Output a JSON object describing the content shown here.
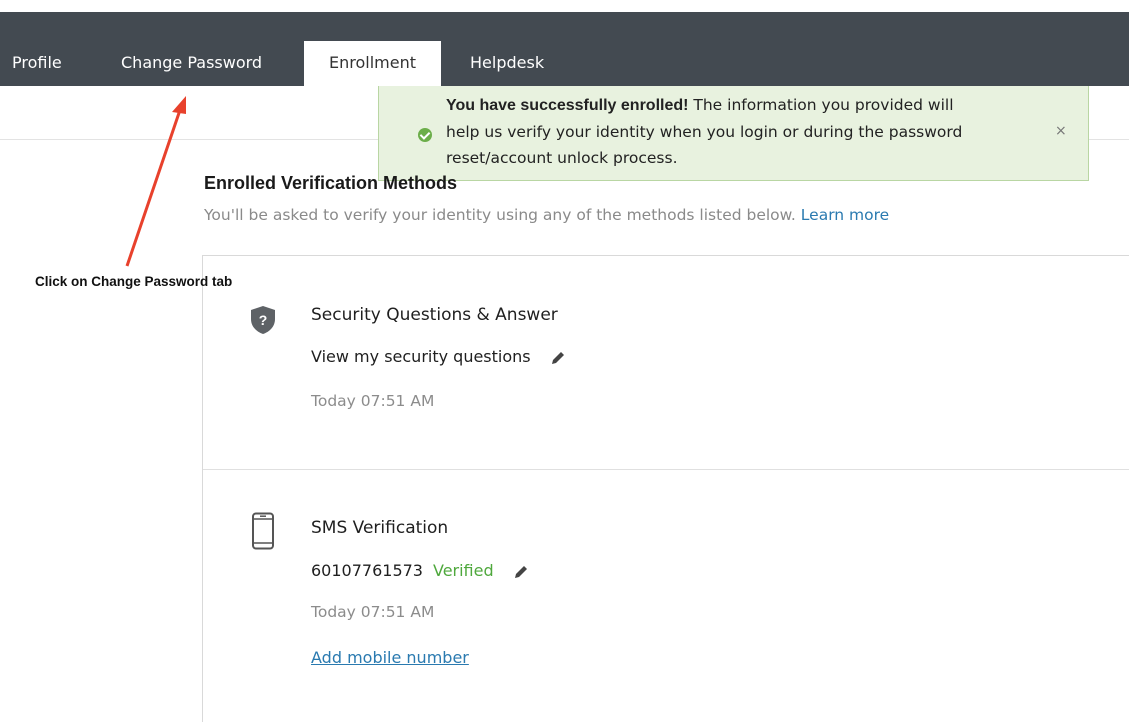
{
  "nav": {
    "tabs": [
      {
        "label": "Profile",
        "active": false
      },
      {
        "label": "Change Password",
        "active": false
      },
      {
        "label": "Enrollment",
        "active": true
      },
      {
        "label": "Helpdesk",
        "active": false
      }
    ]
  },
  "notification": {
    "type": "success",
    "icon": "check-circle-icon",
    "bold_text": "You have successfully enrolled!",
    "text_line1": " The information you provided will",
    "text_line2": "help us verify your identity when you login or during the password",
    "text_line3": "reset/account unlock process.",
    "close_label": "×"
  },
  "section": {
    "title": "Enrolled Verification Methods",
    "subtitle": "You'll be asked to verify your identity using any of the methods listed below.",
    "learn_more": "Learn more"
  },
  "methods": [
    {
      "icon": "shield-question-icon",
      "title": "Security Questions & Answer",
      "link_text": "View my security questions",
      "timestamp": "Today 07:51 AM"
    },
    {
      "icon": "mobile-phone-icon",
      "title": "SMS Verification",
      "phone": "60107761573",
      "status": "Verified",
      "timestamp": "Today 07:51 AM",
      "add_link": "Add mobile number"
    }
  ],
  "annotation": {
    "text": "Click on Change Password tab",
    "color": "#e8412c"
  },
  "colors": {
    "nav_bg": "#434a51",
    "success_bg": "#e8f2df",
    "success_icon": "#6cae4a",
    "link": "#2a7ab0",
    "verified": "#4fa83d"
  }
}
